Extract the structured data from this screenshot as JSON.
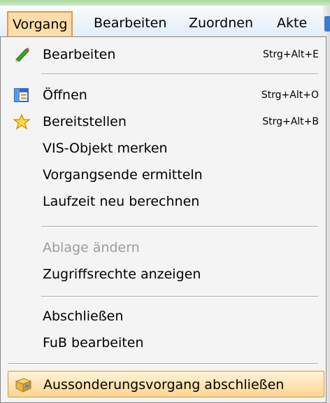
{
  "menubar": {
    "items": [
      {
        "label": "Vorgang",
        "active": true
      },
      {
        "label": "Bearbeiten",
        "active": false
      },
      {
        "label": "Zuordnen",
        "active": false
      },
      {
        "label": "Akte",
        "active": false
      }
    ]
  },
  "dropdown": {
    "items": [
      {
        "label": "Bearbeiten",
        "shortcut": "Strg+Alt+E",
        "icon": "pencil-icon",
        "enabled": true
      },
      {
        "label": "Öffnen",
        "shortcut": "Strg+Alt+O",
        "icon": "window-icon",
        "enabled": true
      },
      {
        "label": "Bereitstellen",
        "shortcut": "Strg+Alt+B",
        "icon": "star-icon",
        "enabled": true
      },
      {
        "label": "VIS-Objekt merken",
        "shortcut": "",
        "icon": "",
        "enabled": true
      },
      {
        "label": "Vorgangsende ermitteln",
        "shortcut": "",
        "icon": "",
        "enabled": true
      },
      {
        "label": "Laufzeit neu berechnen",
        "shortcut": "",
        "icon": "",
        "enabled": true
      },
      {
        "label": "Ablage ändern",
        "shortcut": "",
        "icon": "",
        "enabled": false
      },
      {
        "label": "Zugriffsrechte anzeigen",
        "shortcut": "",
        "icon": "",
        "enabled": true
      },
      {
        "label": "Abschließen",
        "shortcut": "",
        "icon": "",
        "enabled": true
      },
      {
        "label": "FuB bearbeiten",
        "shortcut": "",
        "icon": "",
        "enabled": true
      },
      {
        "label": "Aussonderungsvorgang abschließen",
        "shortcut": "",
        "icon": "archive-box-icon",
        "enabled": true,
        "highlighted": true
      }
    ]
  },
  "colors": {
    "highlight_border": "#d99338",
    "highlight_fill": "#ffd591",
    "disabled_text": "#9c9c9c",
    "menubar_active_border": "#e8963f"
  }
}
